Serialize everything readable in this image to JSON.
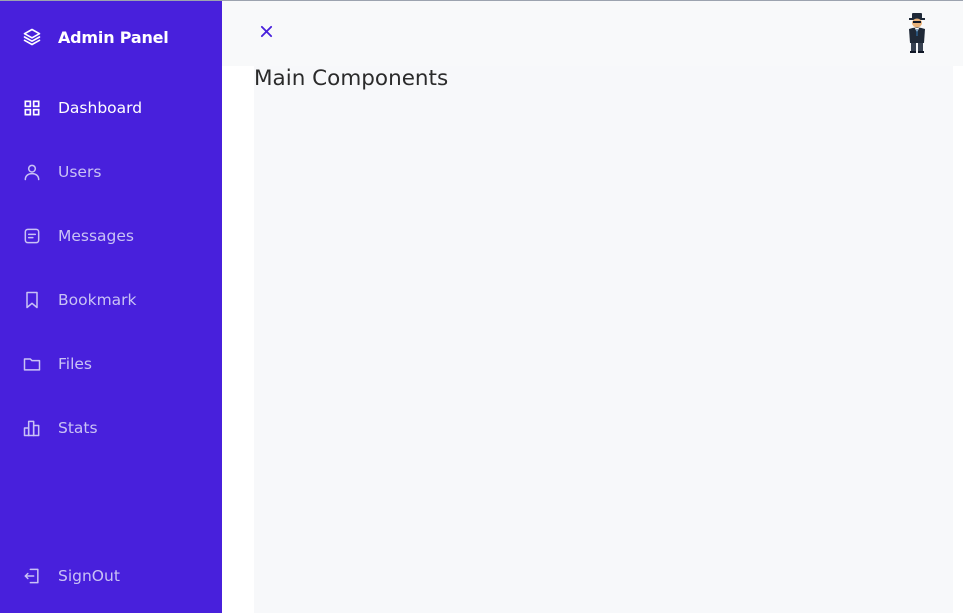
{
  "sidebar": {
    "brand": {
      "title": "Admin Panel",
      "icon": "layers-icon"
    },
    "items": [
      {
        "label": "Dashboard",
        "icon": "grid-icon",
        "active": true
      },
      {
        "label": "Users",
        "icon": "user-icon",
        "active": false
      },
      {
        "label": "Messages",
        "icon": "message-icon",
        "active": false
      },
      {
        "label": "Bookmark",
        "icon": "bookmark-icon",
        "active": false
      },
      {
        "label": "Files",
        "icon": "folder-icon",
        "active": false
      },
      {
        "label": "Stats",
        "icon": "bar-chart-icon",
        "active": false
      }
    ],
    "signout": {
      "label": "SignOut",
      "icon": "logout-icon"
    }
  },
  "topbar": {
    "close_icon": "close-icon",
    "avatar": "avatar-icon"
  },
  "main": {
    "title": "Main Components"
  },
  "colors": {
    "sidebar_bg": "#4820dc",
    "accent": "#4820dc",
    "topbar_bg": "#f8f9fa",
    "main_bg": "#f7f8fa",
    "nav_text": "#c9c2f5",
    "active_text": "#ffffff"
  }
}
